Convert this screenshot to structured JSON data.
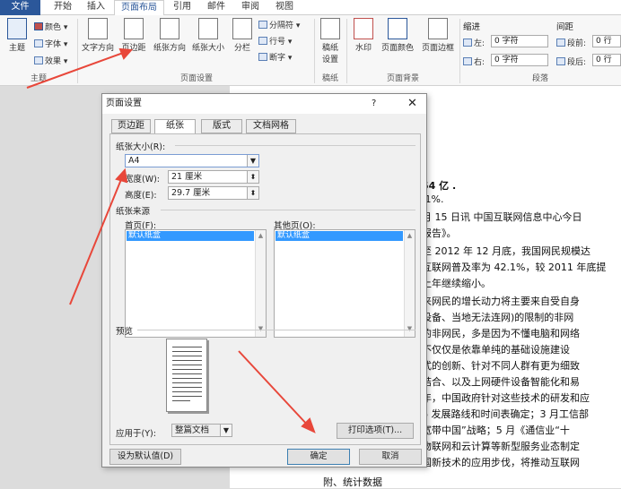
{
  "tabs": {
    "file": "文件",
    "items": [
      "开始",
      "插入",
      "页面布局",
      "引用",
      "邮件",
      "审阅",
      "视图"
    ],
    "active": "页面布局"
  },
  "ribbon": {
    "theme": {
      "label": "主题",
      "colors": "颜色",
      "fonts": "字体",
      "effects": "效果",
      "group": "主题"
    },
    "page_setup": {
      "text_direction": "文字方向",
      "margins": "页边距",
      "orientation": "纸张方向",
      "size": "纸张大小",
      "columns": "分栏",
      "breaks": "分隔符",
      "line_numbers": "行号",
      "hyphenation": "断字",
      "group": "页面设置"
    },
    "draft": {
      "label": "稿纸\n设置",
      "group": "稿纸"
    },
    "background": {
      "watermark": "水印",
      "page_color": "页面颜色",
      "page_border": "页面边框",
      "group": "页面背景"
    },
    "paragraph": {
      "indent": "缩进",
      "spacing": "间距",
      "left_label": "左:",
      "left_value": "0 字符",
      "right_label": "右:",
      "right_value": "0 字符",
      "before_label": "段前:",
      "before_value": "0 行",
      "after_label": "段后:",
      "after_value": "0 行",
      "group": "段落"
    }
  },
  "document": {
    "lines": [
      "54 亿 .",
      ".1%.",
      "月 15 日讯  中国互联网信息中心今日",
      "报告》。",
      "至 2012 年 12 月底，我国网民规模达",
      "互联网普及率为 42.1%，较 2011 年底提",
      "上年继续缩小。",
      "来网民的增长动力将主要来自受自身",
      "设备、当地无法连网)的限制的非网",
      "的非网民，多是因为不懂电脑和网络",
      "  不仅仅是依靠单纯的基础设施建设",
      "式的创新、针对不同人群有更为细致",
      "结合、以及上网硬件设备智能化和易",
      "年，中国政府针对这些技术的研发和应",
      "6 发展路线和时间表确定；3 月工信部",
      "宽带中国”战略；5 月《通信业“十",
      " 物联网和云计算等新型服务业态制定",
      "国新技术的应用步伐，将推动互联网",
      "附、统计数据"
    ]
  },
  "dialog": {
    "title": "页面设置",
    "help": "?",
    "close": "✕",
    "tabs": [
      "页边距",
      "纸张",
      "版式",
      "文档网格"
    ],
    "active_tab": "纸张",
    "paper_size_label": "纸张大小(R):",
    "paper_size_value": "A4",
    "width_label": "宽度(W):",
    "width_value": "21 厘米",
    "height_label": "高度(E):",
    "height_value": "29.7 厘米",
    "source_label": "纸张来源",
    "first_page_label": "首页(F):",
    "first_page_value": "默认纸盒",
    "other_pages_label": "其他页(O):",
    "other_pages_value": "默认纸盒",
    "preview_label": "预览",
    "apply_label": "应用于(Y):",
    "apply_value": "整篇文档",
    "print_options": "打印选项(T)...",
    "set_default": "设为默认值(D)",
    "ok": "确定",
    "cancel": "取消"
  },
  "colors": {
    "accent": "#2b579a",
    "arrow": "#e8473a",
    "selection": "#3399ff"
  }
}
